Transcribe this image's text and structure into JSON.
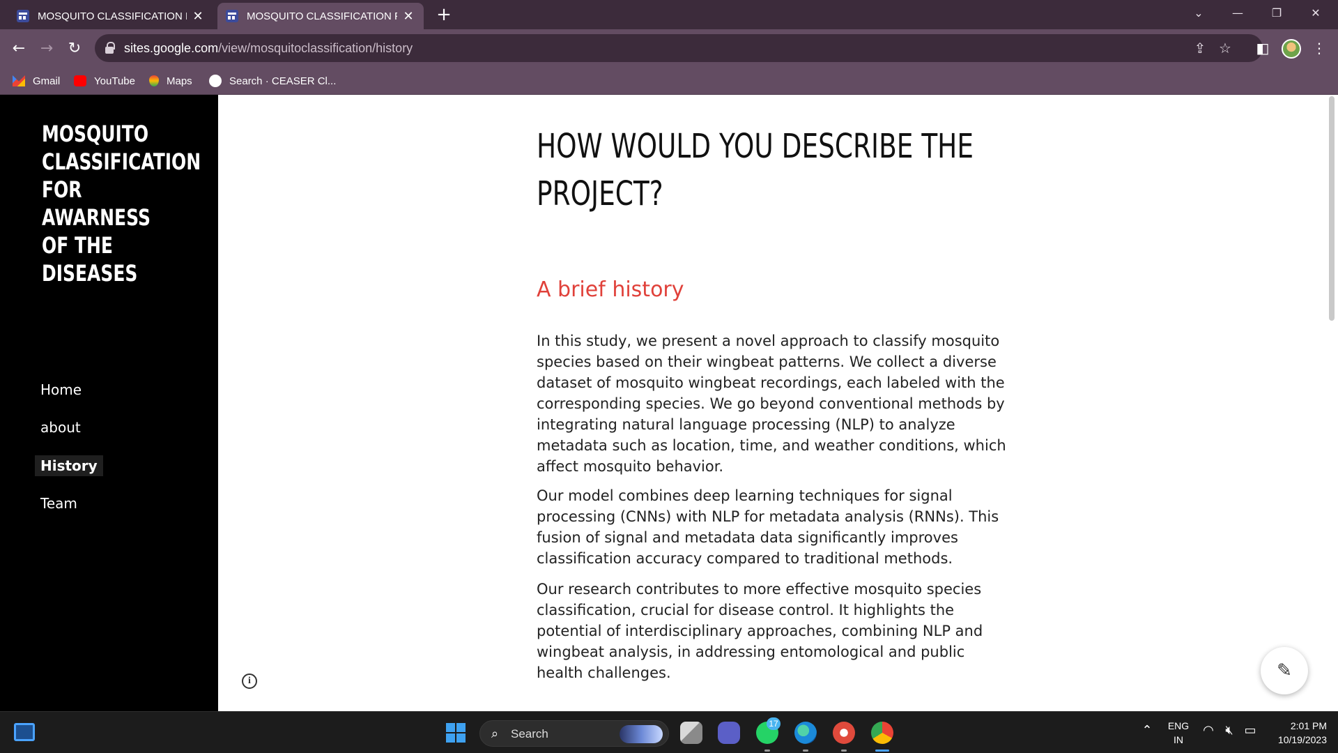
{
  "browser": {
    "tabs": [
      {
        "label": "MOSQUITO CLASSIFICATION FO",
        "active": false
      },
      {
        "label": "MOSQUITO CLASSIFICATION FO",
        "active": true
      }
    ],
    "url_domain": "sites.google.com",
    "url_path": "/view/mosquitoclassification/history",
    "bookmarks": [
      {
        "label": "Gmail",
        "icon": "gmail-icon"
      },
      {
        "label": "YouTube",
        "icon": "youtube-icon"
      },
      {
        "label": "Maps",
        "icon": "maps-icon"
      },
      {
        "label": "Search · CEASER Cl...",
        "icon": "github-icon"
      }
    ]
  },
  "site": {
    "title": "MOSQUITO CLASSIFICATION FOR AWARNESS OF THE DISEASES",
    "nav": [
      {
        "label": "Home",
        "current": false
      },
      {
        "label": "about",
        "current": false
      },
      {
        "label": "History",
        "current": true
      },
      {
        "label": "Team",
        "current": false
      }
    ]
  },
  "content": {
    "heading": "HOW WOULD YOU DESCRIBE THE PROJECT?",
    "subheading": "A brief history",
    "paragraphs": [
      "In this study, we present a novel approach to classify mosquito species based on their wingbeat patterns. We collect a diverse dataset of mosquito wingbeat recordings, each labeled with the corresponding species. We go beyond conventional methods by integrating natural language processing (NLP) to analyze metadata such as location, time, and weather conditions, which affect mosquito behavior.",
      "Our model combines deep learning techniques for signal processing (CNNs) with NLP for metadata analysis (RNNs). This fusion of signal and metadata data significantly improves classification accuracy compared to traditional methods.",
      "Our research contributes to more effective mosquito species classification, crucial for disease control. It highlights the potential of interdisciplinary approaches, combining NLP and wingbeat analysis, in addressing entomological and public health challenges."
    ],
    "subheading_color": "#e0413a"
  },
  "taskbar": {
    "search_label": "Search",
    "whatsapp_badge": "17",
    "language": "ENG",
    "region": "IN",
    "time": "2:01 PM",
    "date": "10/19/2023"
  }
}
